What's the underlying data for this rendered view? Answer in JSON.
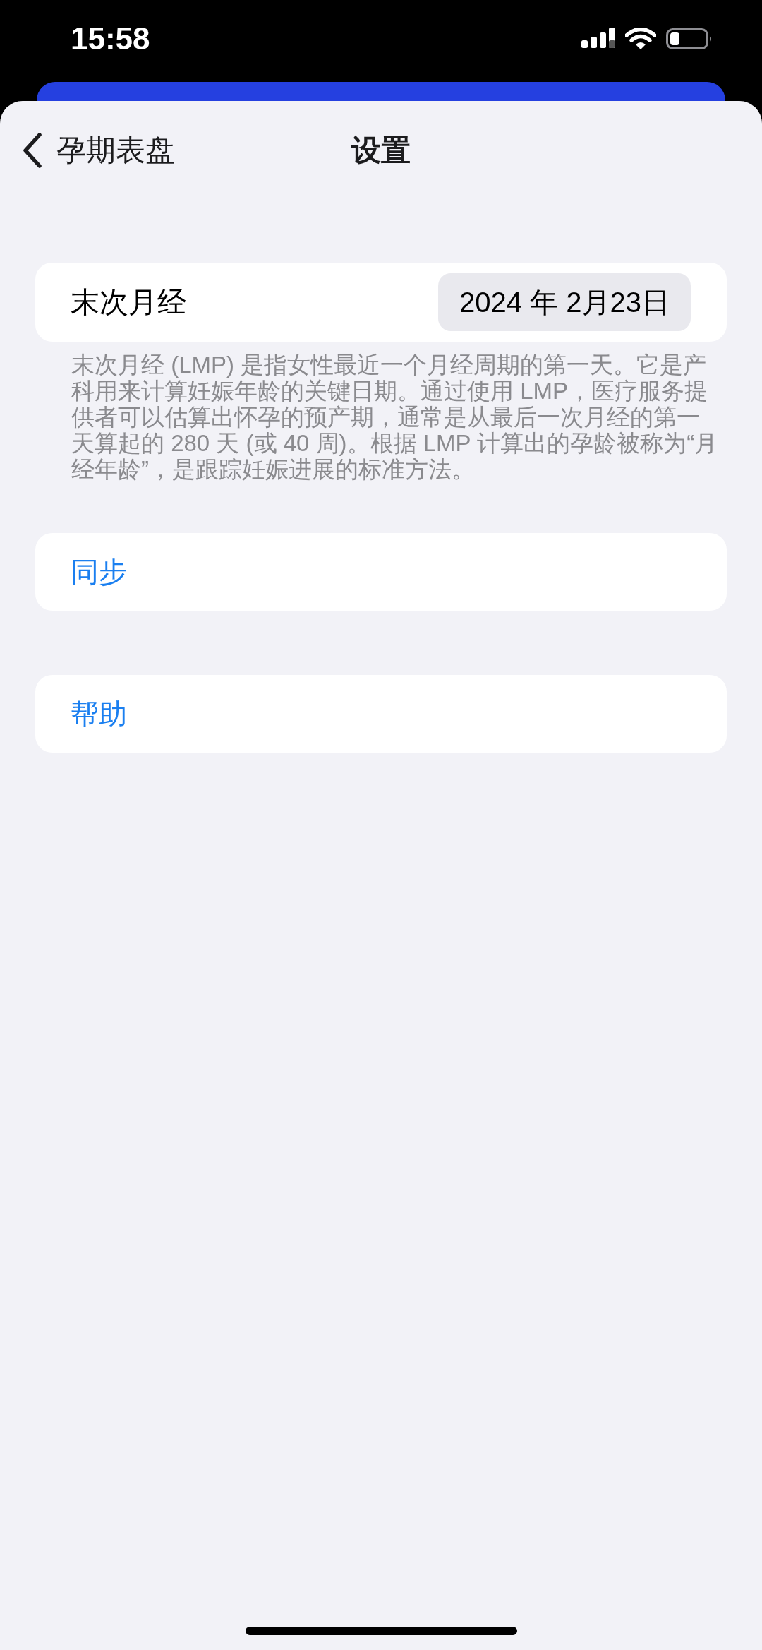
{
  "status_bar": {
    "time": "15:58"
  },
  "nav_bar": {
    "back_label": "孕期表盘",
    "title": "设置"
  },
  "lmp_row": {
    "label": "末次月经",
    "value": "2024 年 2月23日"
  },
  "lmp_footer": "末次月经 (LMP) 是指女性最近一个月经周期的第一天。它是产科用来计算妊娠年龄的关键日期。通过使用 LMP，医疗服务提供者可以估算出怀孕的预产期，通常是从最后一次月经的第一天算起的 280 天 (或 40 周)。根据 LMP 计算出的孕龄被称为“月经年龄”，是跟踪妊娠进展的标准方法。",
  "actions": [
    {
      "label": "同步"
    },
    {
      "label": "帮助"
    }
  ]
}
